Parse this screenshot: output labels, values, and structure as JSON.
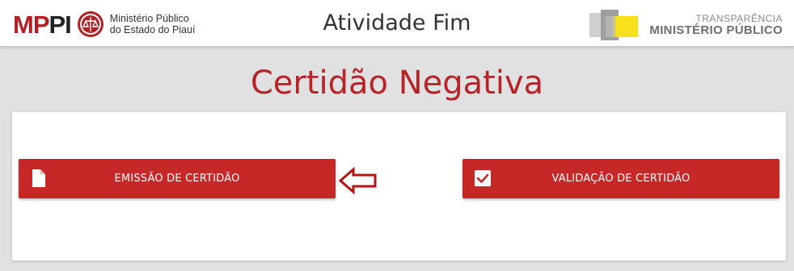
{
  "header": {
    "logo": {
      "mp": "MP",
      "pi": "PI",
      "line1": "Ministério Público",
      "line2": "do Estado do Piauí"
    },
    "title": "Atividade Fim",
    "transparencia": {
      "top": "TRANSPARÊNCIA",
      "bottom": "MINISTÉRIO PÚBLICO"
    }
  },
  "main": {
    "title": "Certidão Negativa",
    "buttons": [
      {
        "label": "EMISSÃO DE CERTIDÃO",
        "icon": "document-icon"
      },
      {
        "label": "VALIDAÇÃO DE CERTIDÃO",
        "icon": "checkbox-icon"
      }
    ],
    "annotation_icon": "left-arrow-icon"
  },
  "colors": {
    "brand_red": "#c62828",
    "title_red": "#b42428",
    "background": "#e1e1e1"
  }
}
